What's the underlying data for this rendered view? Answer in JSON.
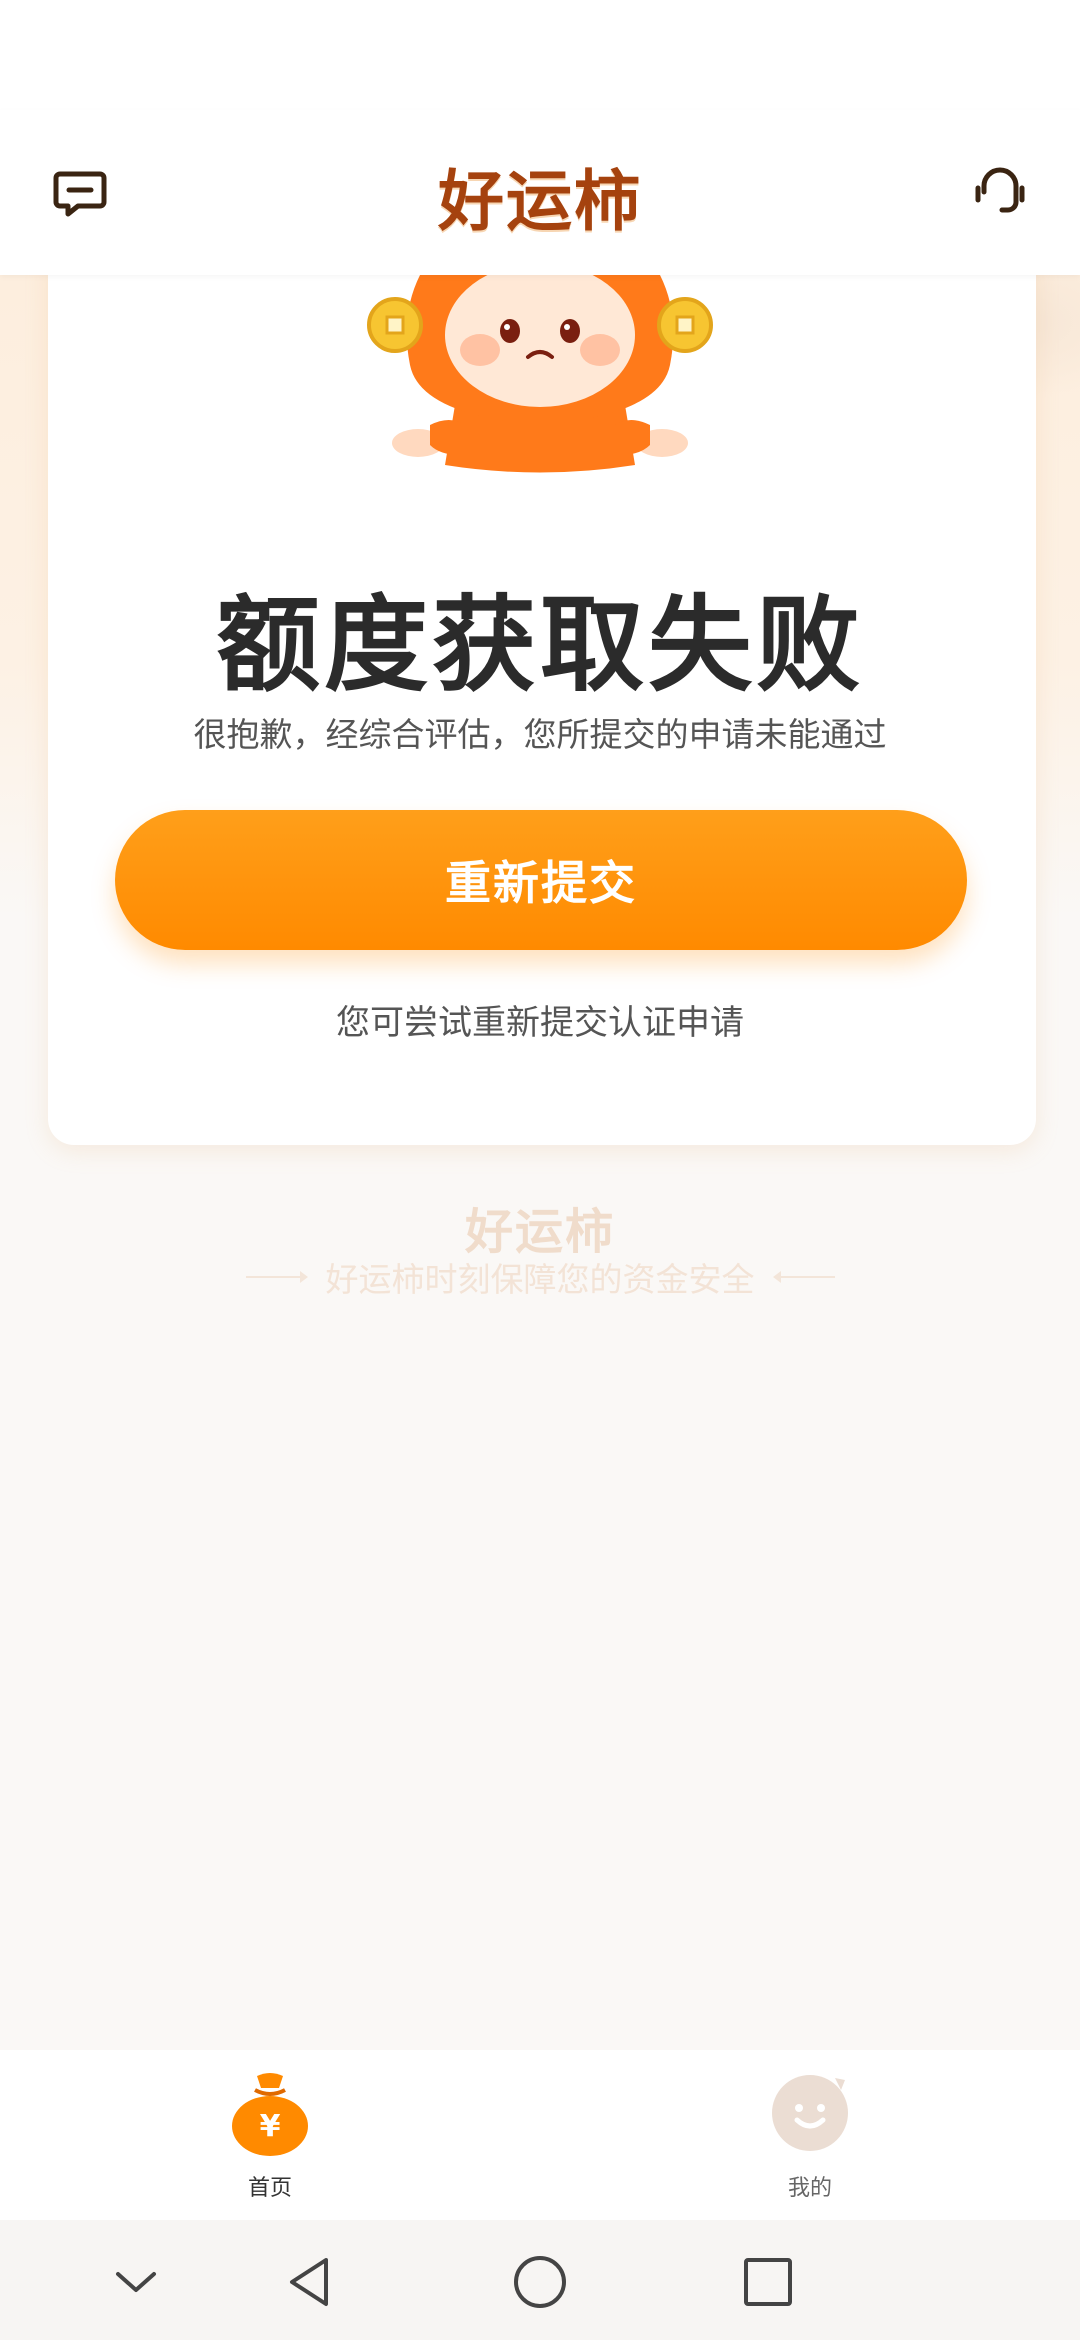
{
  "header": {
    "title": "好运柿",
    "left_icon": "message-icon",
    "right_icon": "headset-icon"
  },
  "result": {
    "title": "额度获取失败",
    "subtitle": "很抱歉，经综合评估，您所提交的申请未能通过",
    "button_label": "重新提交",
    "hint": "您可尝试重新提交认证申请"
  },
  "footer_brand": {
    "name": "好运柿",
    "slogan": "好运柿时刻保障您的资金安全"
  },
  "tabbar": {
    "items": [
      {
        "label": "首页",
        "icon": "money-bag-icon",
        "active": true
      },
      {
        "label": "我的",
        "icon": "smile-avatar-icon",
        "active": false
      }
    ]
  },
  "system_nav": [
    "collapse-icon",
    "back-icon",
    "home-icon",
    "recents-icon"
  ],
  "colors": {
    "brand": "#a5420e",
    "accent": "#ff8a00",
    "text_primary": "#2b2b2b",
    "text_secondary": "#555555"
  }
}
